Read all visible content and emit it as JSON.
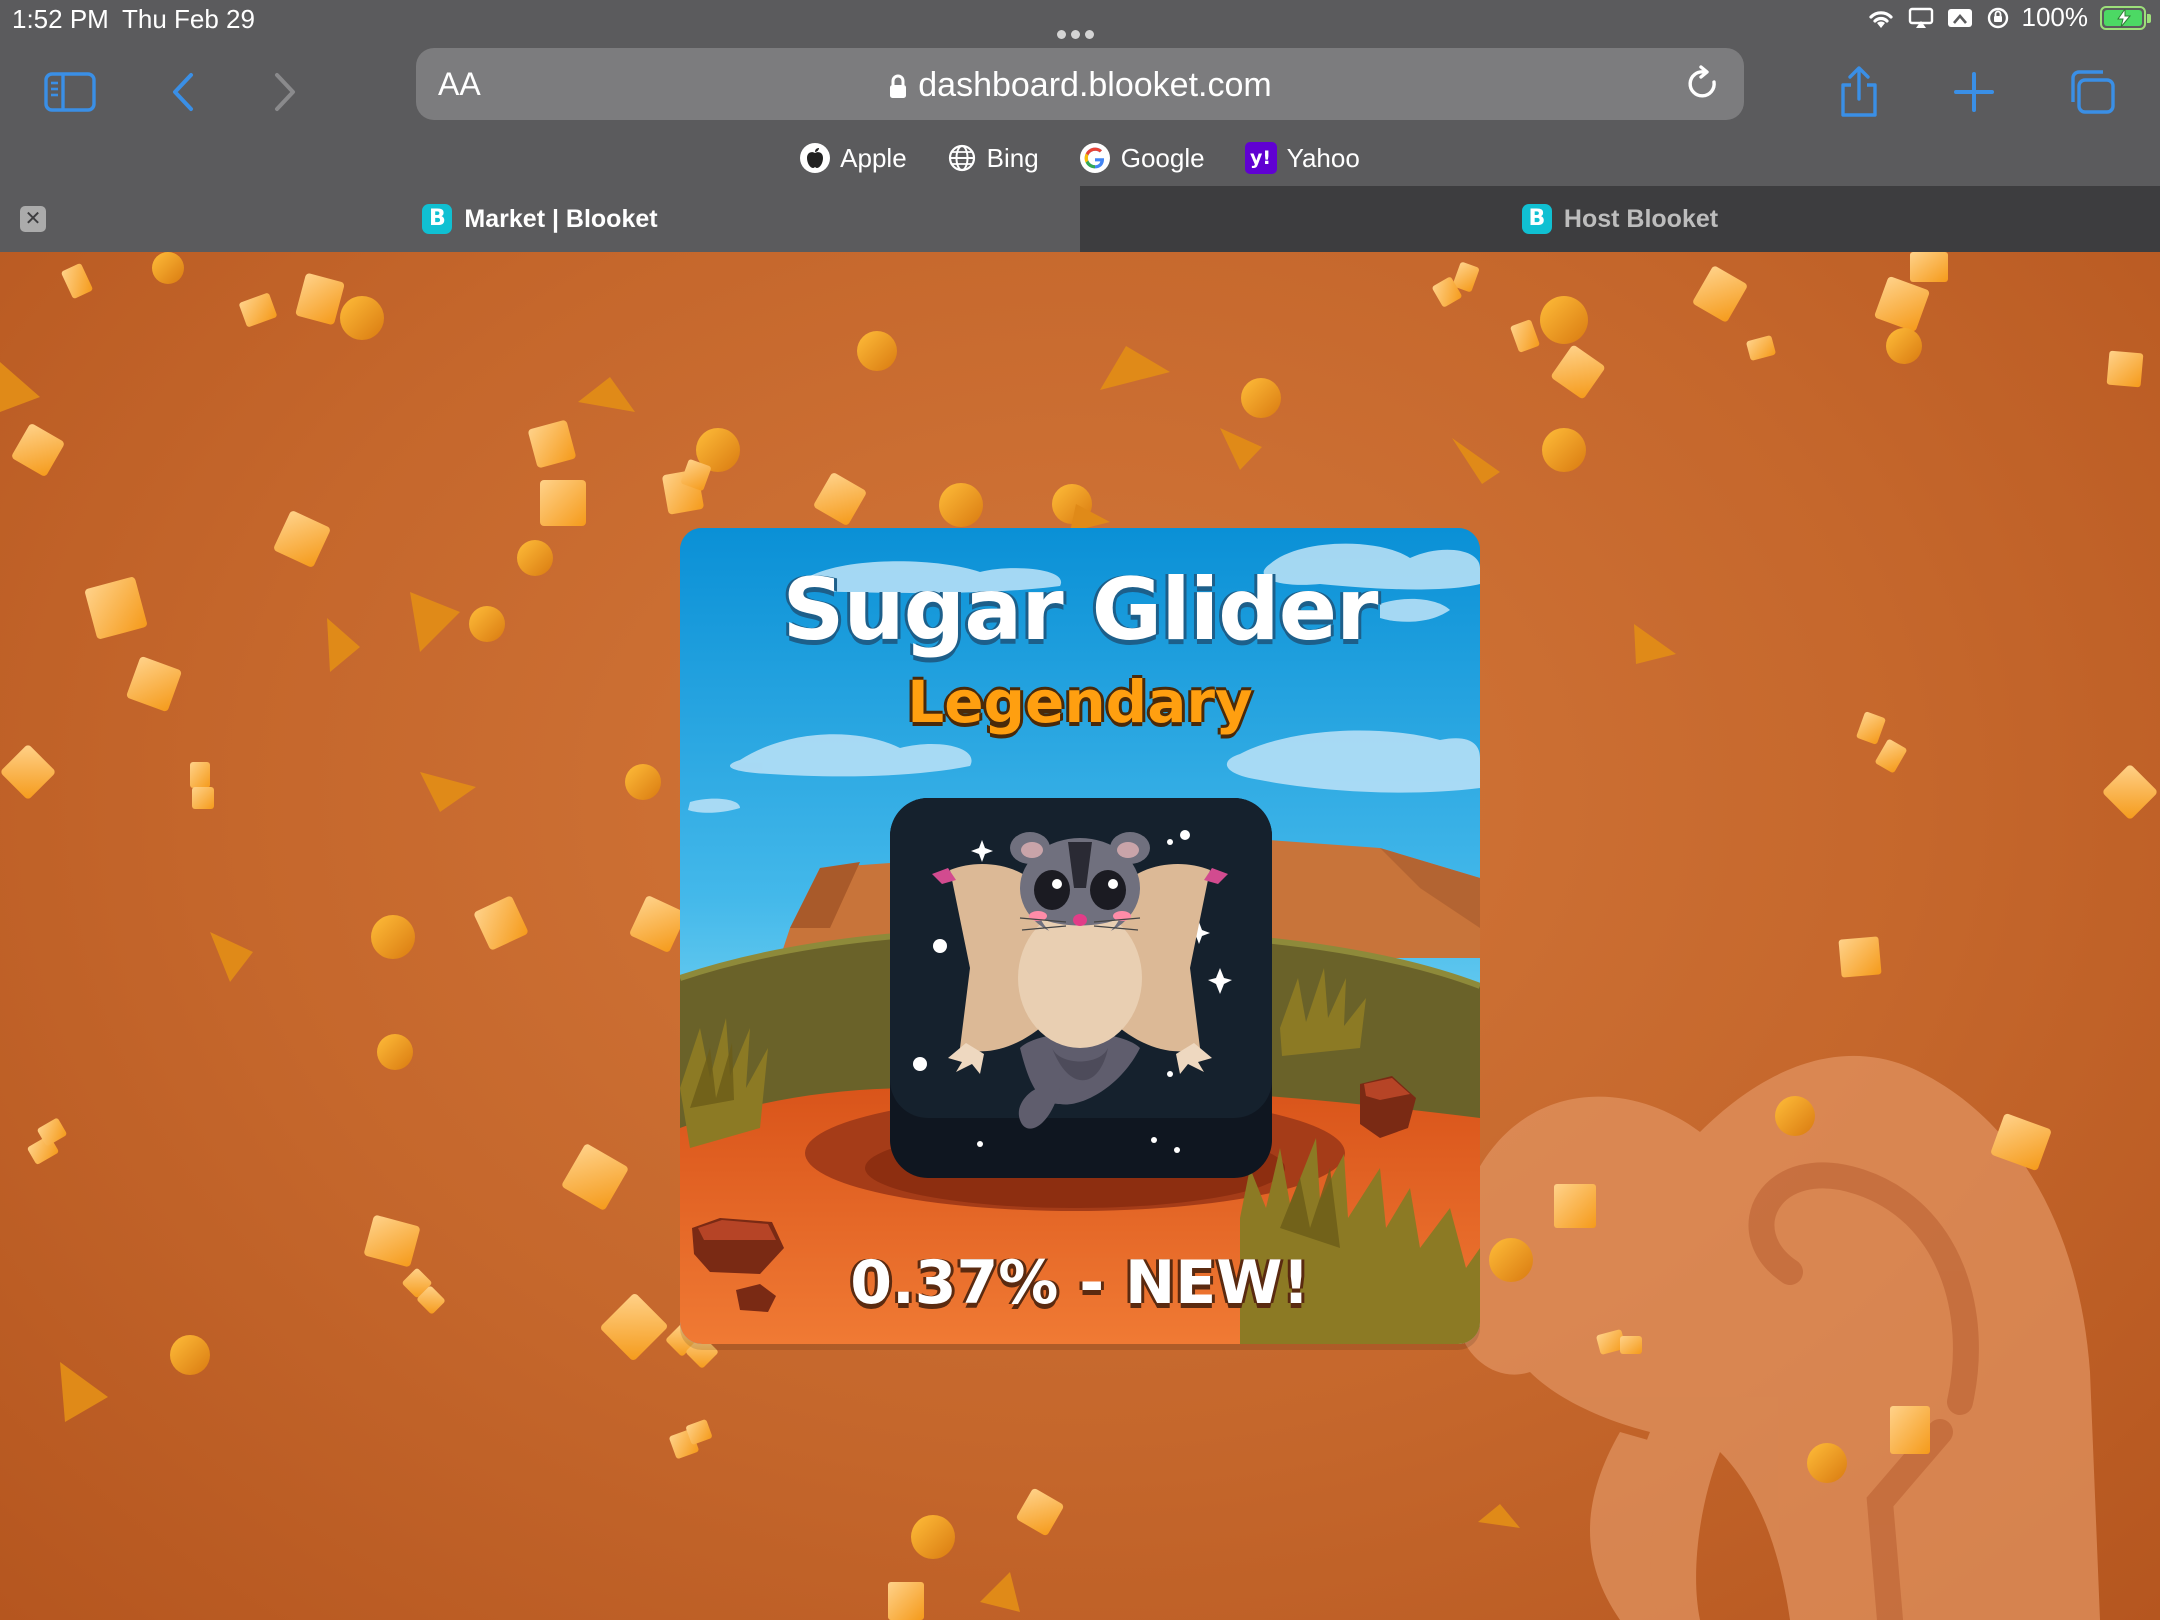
{
  "status_bar": {
    "time": "1:52 PM",
    "date": "Thu Feb 29",
    "battery_text": "100%"
  },
  "browser": {
    "text_size_label": "AA",
    "url": "dashboard.blooket.com",
    "favorites": [
      {
        "label": "Apple",
        "icon": "apple-icon"
      },
      {
        "label": "Bing",
        "icon": "globe-icon"
      },
      {
        "label": "Google",
        "icon": "google-icon"
      },
      {
        "label": "Yahoo",
        "icon": "yahoo-icon"
      }
    ],
    "tabs": [
      {
        "title": "Market | Blooket",
        "active": true
      },
      {
        "title": "Host Blooket",
        "active": false
      }
    ],
    "tab_icon_letter": "B"
  },
  "blook_card": {
    "name": "Sugar Glider",
    "rarity": "Legendary",
    "chance_text": "0.37% - NEW!",
    "rarity_color": "#ff9f10"
  },
  "colors": {
    "background": "#c4662c",
    "accent_blue": "#3a8fe6",
    "blooket_teal": "#10c0d2"
  }
}
